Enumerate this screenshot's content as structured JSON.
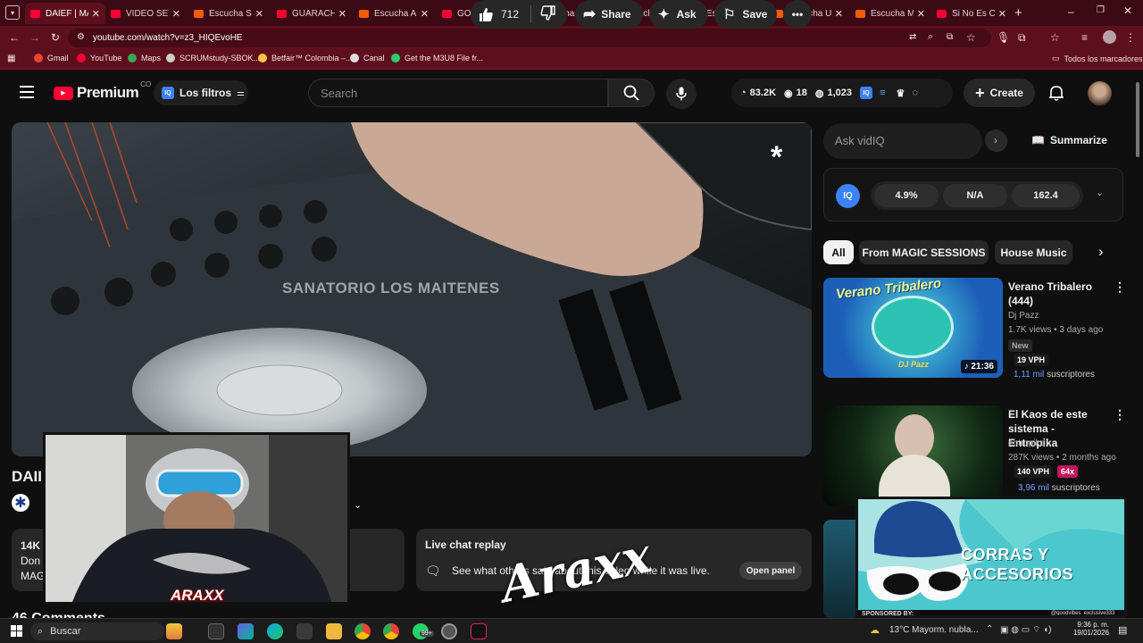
{
  "tabs": [
    {
      "label": "DAIEF | MAG",
      "active": true,
      "icon": "youtube-icon"
    },
    {
      "label": "VIDEO SET 1",
      "icon": "youtube-icon"
    },
    {
      "label": "Escucha SOL",
      "icon": "soundcloud-icon"
    },
    {
      "label": "GUARACHA",
      "icon": "youtube-icon"
    },
    {
      "label": "Escucha A LI",
      "icon": "soundcloud-icon"
    },
    {
      "label": "GOODVIBES",
      "icon": "youtube-icon"
    },
    {
      "label": "Escucha VAI",
      "icon": "soundcloud-icon"
    },
    {
      "label": "Escucha LEY",
      "icon": "soundcloud-icon"
    },
    {
      "label": "Escucha OTI",
      "icon": "soundcloud-icon"
    },
    {
      "label": "Escucha Unc",
      "icon": "soundcloud-icon"
    },
    {
      "label": "Escucha MA",
      "icon": "soundcloud-icon"
    },
    {
      "label": "Si No Es Co",
      "icon": "youtube-icon"
    }
  ],
  "browser": {
    "url": "youtube.com/watch?v=z3_HIQEvoHE"
  },
  "bookmarks": [
    "Gmail",
    "YouTube",
    "Maps",
    "SCRUMstudy-SBOK...",
    "Betfair™ Colombia –...",
    "Canal",
    "Get the M3U8 File fr..."
  ],
  "bookmarks_all": "Todos los marcadores",
  "header": {
    "logo": "Premium",
    "logo_sup": "CO",
    "filters": "Los filtros",
    "search_placeholder": "Search",
    "stats": {
      "views": "83.2K",
      "likes": "18",
      "comments": "1,023"
    },
    "create": "Create"
  },
  "video": {
    "overlay_text": "SANATORIO LOS MAITENES",
    "title_partial": "DAII",
    "likes": "712",
    "actions": {
      "share": "Share",
      "ask": "Ask",
      "save": "Save"
    }
  },
  "description_partial": {
    "line1": "14K",
    "line2": "Don",
    "line3": "MAG"
  },
  "live_chat": {
    "title": "Live chat replay",
    "text": "See what others said about this video while it was live.",
    "button": "Open panel"
  },
  "comments_partial": "46 Comments",
  "vidiq": {
    "ask_placeholder": "Ask vidIQ",
    "summarize": "Summarize",
    "metrics": [
      "4.9%",
      "N/A",
      "162.4"
    ]
  },
  "chips": [
    "All",
    "From MAGIC SESSIONS",
    "House Music"
  ],
  "recommendations": [
    {
      "title": "Verano Tribalero (444)",
      "channel": "Dj Pazz",
      "meta": "1.7K views • 3 days ago",
      "new": "New",
      "vph": "19 VPH",
      "subs_num": "1,11 mil",
      "subs_label": "suscriptores",
      "duration": "21:36",
      "thumb_text": "Verano Tribalero",
      "thumb_sub": "DJ Pazz"
    },
    {
      "title": "El Kaos de este sistema - Entropika",
      "channel": "entropika",
      "meta": "287K views • 2 months ago",
      "vph": "140 VPH",
      "mult": "64x",
      "subs_num": "3,96 mil",
      "subs_label": "suscriptores"
    }
  ],
  "webcam": {
    "name": "ARAXX"
  },
  "signature": "Araxx",
  "ad": {
    "line1": "CORRAS Y",
    "line2": "ACCESORIOS",
    "sponsored": "SPONSORED BY:",
    "handle": "@goodvibes_exclusive333"
  },
  "taskbar": {
    "search": "Buscar",
    "weather": "13°C",
    "weather_text": "Mayorm. nubla...",
    "time": "9:36 p. m.",
    "date": "19/01/2026",
    "badge": "99+"
  }
}
